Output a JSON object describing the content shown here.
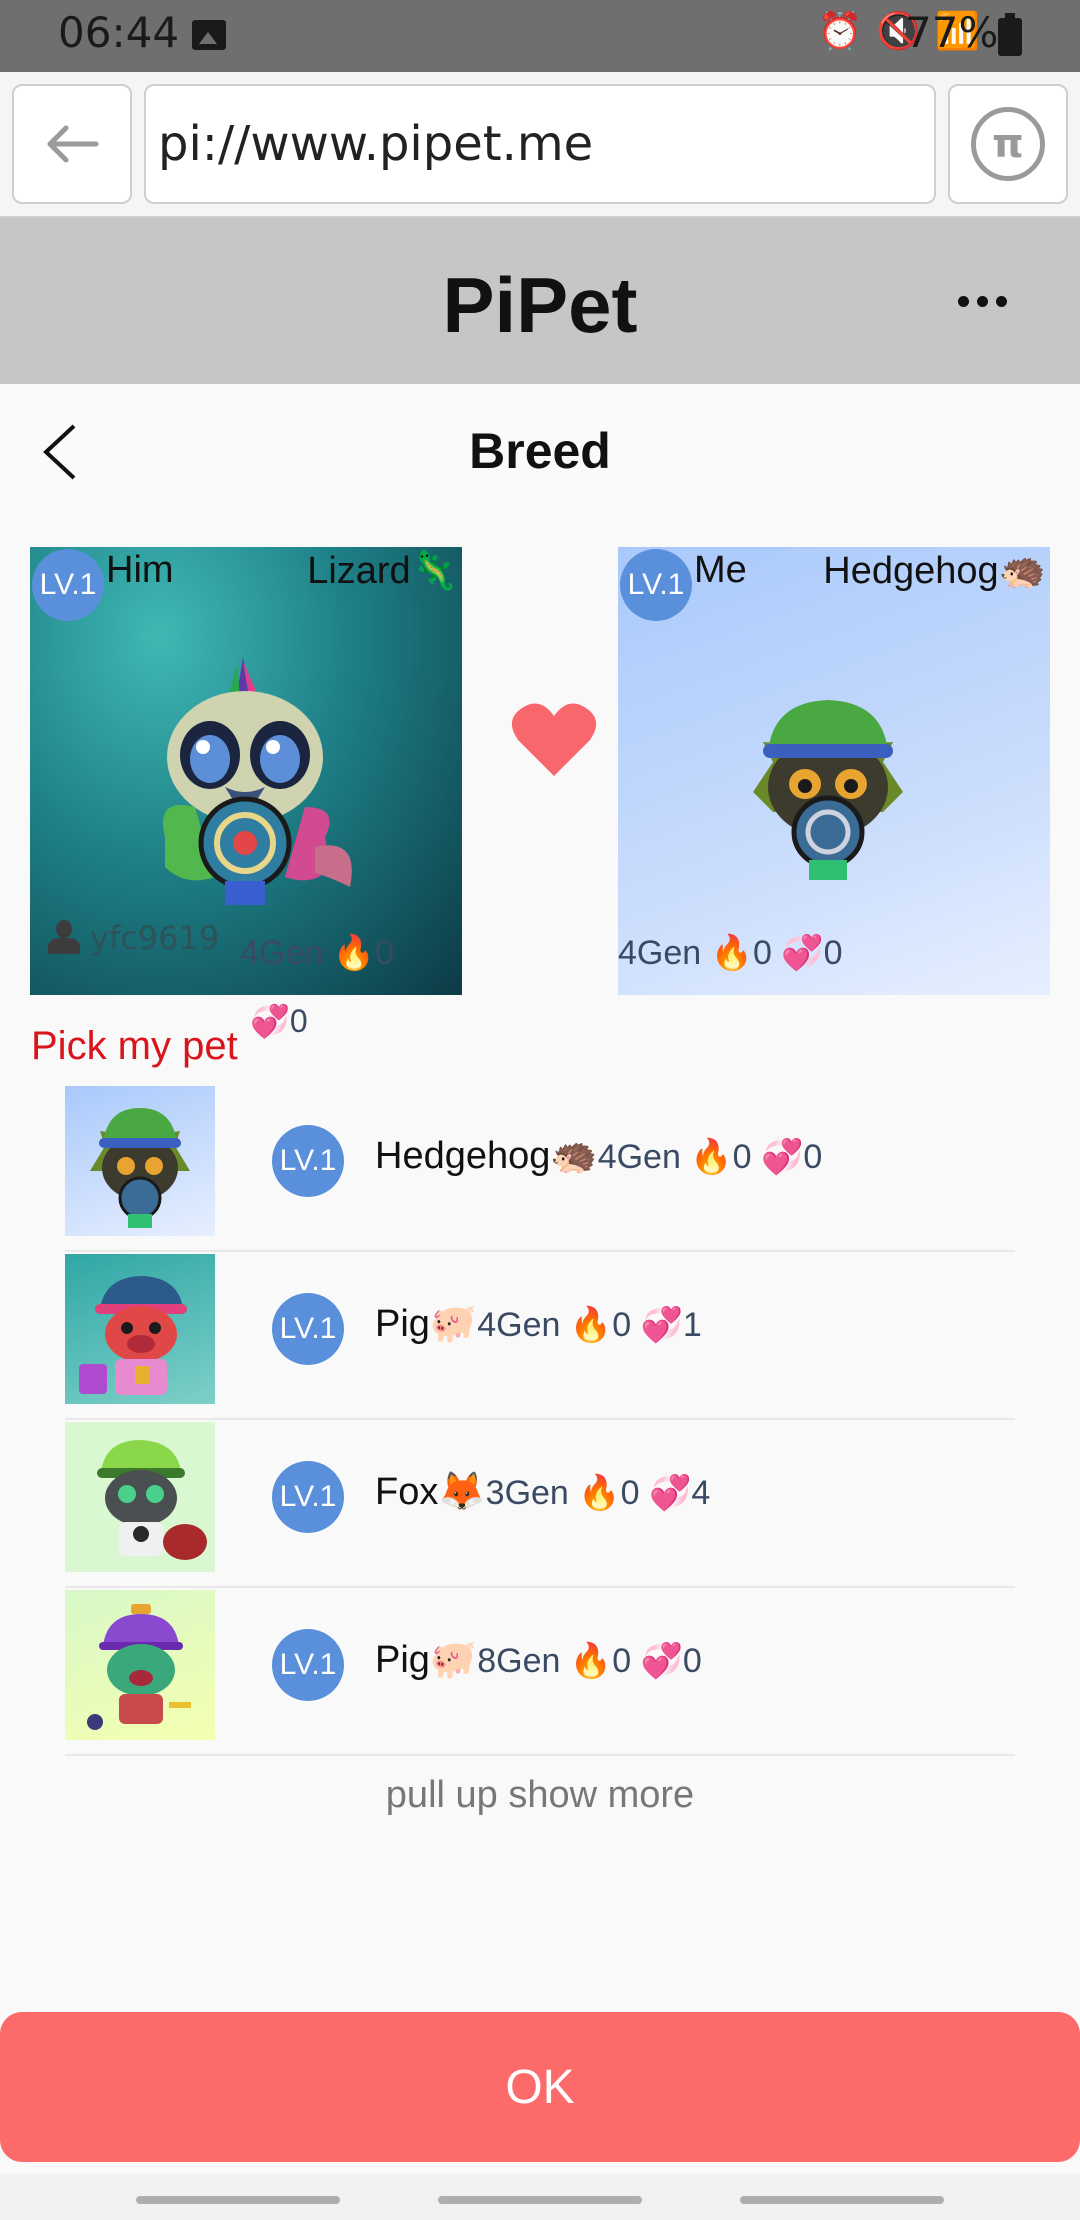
{
  "status_bar": {
    "time": "06:44",
    "battery": "77%"
  },
  "browser": {
    "url": "pi://www.pipet.me",
    "pi_symbol": "π"
  },
  "app": {
    "title": "PiPet"
  },
  "page": {
    "title": "Breed"
  },
  "him_card": {
    "level": "LV.1",
    "role": "Him",
    "species": "Lizard🦎",
    "owner": "yfc9619",
    "stats": "4Gen 🔥0",
    "extra_stat": "💞0"
  },
  "me_card": {
    "level": "LV.1",
    "role": "Me",
    "species": "Hedgehog🦔",
    "stats": "4Gen 🔥0 💞0"
  },
  "pick_label": "Pick my pet",
  "pets": [
    {
      "level": "LV.1",
      "name": "Hedgehog🦔",
      "stats": "4Gen 🔥0 💞0"
    },
    {
      "level": "LV.1",
      "name": "Pig🐖",
      "stats": "4Gen 🔥0 💞1"
    },
    {
      "level": "LV.1",
      "name": "Fox🦊",
      "stats": "3Gen 🔥0 💞4"
    },
    {
      "level": "LV.1",
      "name": "Pig🐖",
      "stats": "8Gen 🔥0 💞0"
    }
  ],
  "show_more": "pull up show more",
  "ok_label": "OK"
}
